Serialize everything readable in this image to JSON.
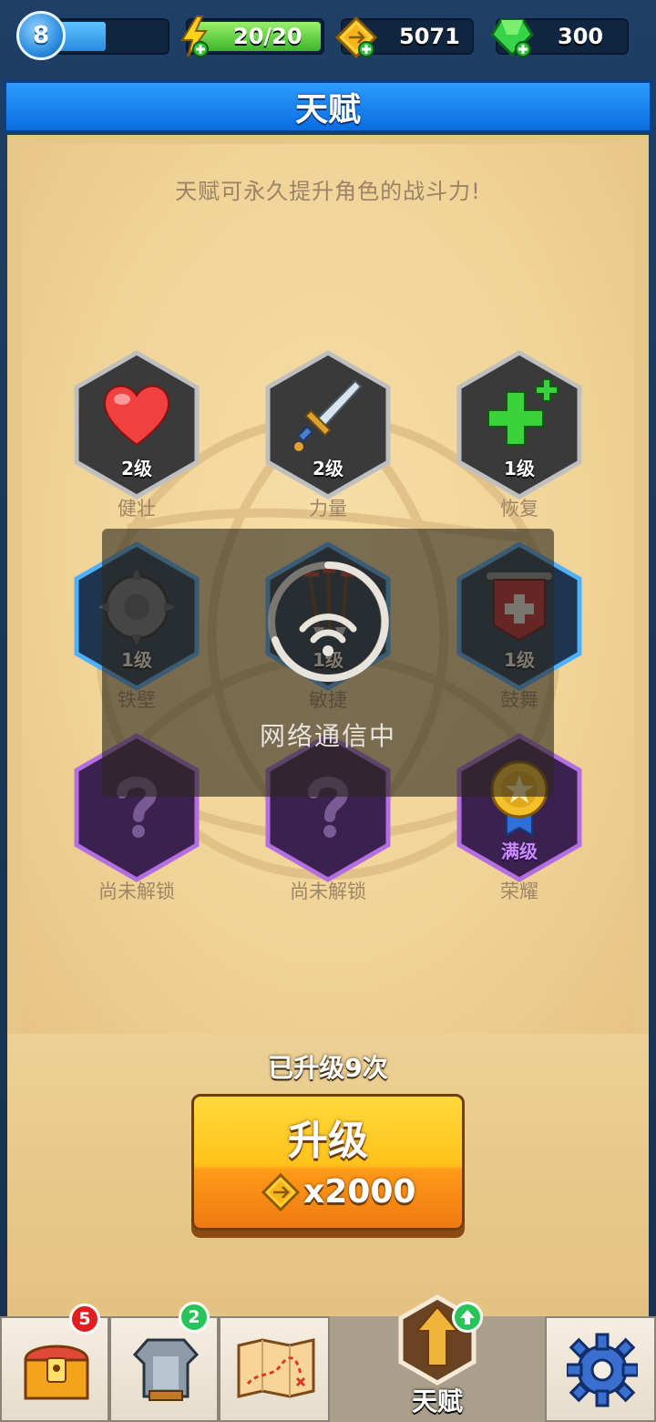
{
  "colors": {
    "title_blue": "#0b6de0",
    "parchment": "#f0d397",
    "button_gold": "#ffc21a",
    "locked_purple": "#3a2150",
    "frame_navy": "#1f3f66"
  },
  "top_bar": {
    "player_level": "8",
    "xp_progress": 0.5,
    "energy": "20/20",
    "gold": "5071",
    "gems": "300"
  },
  "header": {
    "title": "天赋"
  },
  "talents": {
    "subtitle": "天赋可永久提升角色的战斗力!",
    "items": [
      {
        "name": "健壮",
        "level": "2级",
        "icon": "heart-icon",
        "state": "active"
      },
      {
        "name": "力量",
        "level": "2级",
        "icon": "sword-icon",
        "state": "active"
      },
      {
        "name": "恢复",
        "level": "1级",
        "icon": "green-cross-icon",
        "state": "active"
      },
      {
        "name": "铁壁",
        "level": "1级",
        "icon": "spiked-shield-icon",
        "state": "blue"
      },
      {
        "name": "敏捷",
        "level": "1级",
        "icon": "arrows-icon",
        "state": "blue"
      },
      {
        "name": "鼓舞",
        "level": "1级",
        "icon": "banner-icon",
        "state": "blue"
      },
      {
        "name": "尚未解锁",
        "level": "",
        "icon": "question-mark-icon",
        "state": "locked"
      },
      {
        "name": "尚未解锁",
        "level": "",
        "icon": "question-mark-icon",
        "state": "locked"
      },
      {
        "name": "荣耀",
        "level": "满级",
        "icon": "medal-icon",
        "state": "max"
      }
    ]
  },
  "overlay": {
    "text": "网络通信中",
    "icon": "wifi-spinner-icon"
  },
  "upgrade": {
    "count_text": "已升级9次",
    "button_label": "升级",
    "cost": "x2000",
    "cost_icon": "gold-coin-icon"
  },
  "bottom_nav": {
    "items": [
      {
        "icon": "treasure-chest-icon",
        "badge": "5"
      },
      {
        "icon": "armor-icon",
        "badge": "2"
      },
      {
        "icon": "map-icon",
        "badge": ""
      },
      {
        "icon": "talent-arrow-icon",
        "label": "天赋",
        "active": true
      },
      {
        "icon": "gear-icon",
        "badge": ""
      }
    ]
  }
}
